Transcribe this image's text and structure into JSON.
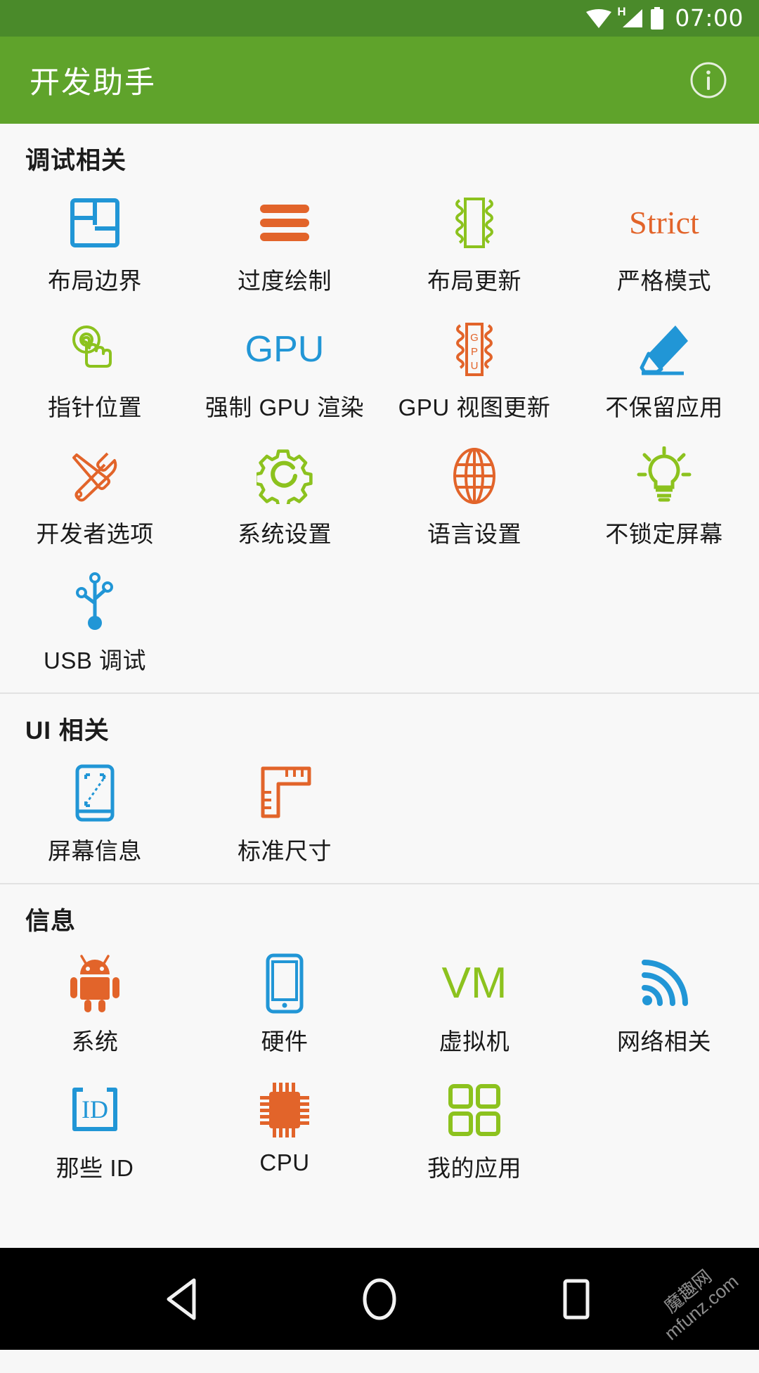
{
  "status_bar": {
    "time": "07:00",
    "icons": [
      "wifi-icon",
      "signal-h-icon",
      "battery-icon"
    ],
    "signal_label": "H"
  },
  "app_bar": {
    "title": "开发助手",
    "info_label": "i"
  },
  "colors": {
    "status_bar_bg": "#4a8a2a",
    "app_bar_bg": "#5fa32b",
    "page_bg": "#f8f8f8",
    "blue": "#2196d6",
    "orange": "#e2642a",
    "green": "#8cc21e",
    "text": "#1a1a1a",
    "nav_bg": "#000000"
  },
  "sections": [
    {
      "title": "调试相关",
      "items": [
        {
          "label": "布局边界",
          "icon": "layout-bounds-icon",
          "color": "#2196d6"
        },
        {
          "label": "过度绘制",
          "icon": "overdraw-icon",
          "color": "#e2642a"
        },
        {
          "label": "布局更新",
          "icon": "layout-update-icon",
          "color": "#8cc21e"
        },
        {
          "label": "严格模式",
          "icon": "strict-mode-icon",
          "color": "#e2642a",
          "text": "Strict"
        },
        {
          "label": "指针位置",
          "icon": "pointer-location-icon",
          "color": "#8cc21e"
        },
        {
          "label": "强制 GPU 渲染",
          "icon": "gpu-render-icon",
          "color": "#2196d6",
          "text": "GPU"
        },
        {
          "label": "GPU 视图更新",
          "icon": "gpu-view-update-icon",
          "color": "#e2642a",
          "text": "GPU"
        },
        {
          "label": "不保留应用",
          "icon": "eraser-icon",
          "color": "#2196d6"
        },
        {
          "label": "开发者选项",
          "icon": "tools-icon",
          "color": "#e2642a"
        },
        {
          "label": "系统设置",
          "icon": "gear-icon",
          "color": "#8cc21e"
        },
        {
          "label": "语言设置",
          "icon": "globe-icon",
          "color": "#e2642a"
        },
        {
          "label": "不锁定屏幕",
          "icon": "lightbulb-icon",
          "color": "#8cc21e"
        },
        {
          "label": "USB 调试",
          "icon": "usb-icon",
          "color": "#2196d6"
        }
      ]
    },
    {
      "title": "UI 相关",
      "items": [
        {
          "label": "屏幕信息",
          "icon": "screen-info-icon",
          "color": "#2196d6"
        },
        {
          "label": "标准尺寸",
          "icon": "ruler-icon",
          "color": "#e2642a"
        }
      ]
    },
    {
      "title": "信息",
      "items": [
        {
          "label": "系统",
          "icon": "android-icon",
          "color": "#e2642a"
        },
        {
          "label": "硬件",
          "icon": "phone-icon",
          "color": "#2196d6"
        },
        {
          "label": "虚拟机",
          "icon": "vm-icon",
          "color": "#8cc21e",
          "text": "VM"
        },
        {
          "label": "网络相关",
          "icon": "wifi-signal-icon",
          "color": "#2196d6"
        },
        {
          "label": "那些 ID",
          "icon": "id-icon",
          "color": "#2196d6",
          "text": "ID"
        },
        {
          "label": "CPU",
          "icon": "cpu-chip-icon",
          "color": "#e2642a"
        },
        {
          "label": "我的应用",
          "icon": "apps-grid-icon",
          "color": "#8cc21e"
        }
      ]
    }
  ],
  "nav_bar": {
    "back_label": "back-triangle",
    "home_label": "home-circle",
    "recents_label": "recents-square"
  },
  "watermark": {
    "line1": "魔趣网",
    "line2": "mfunz.com"
  }
}
